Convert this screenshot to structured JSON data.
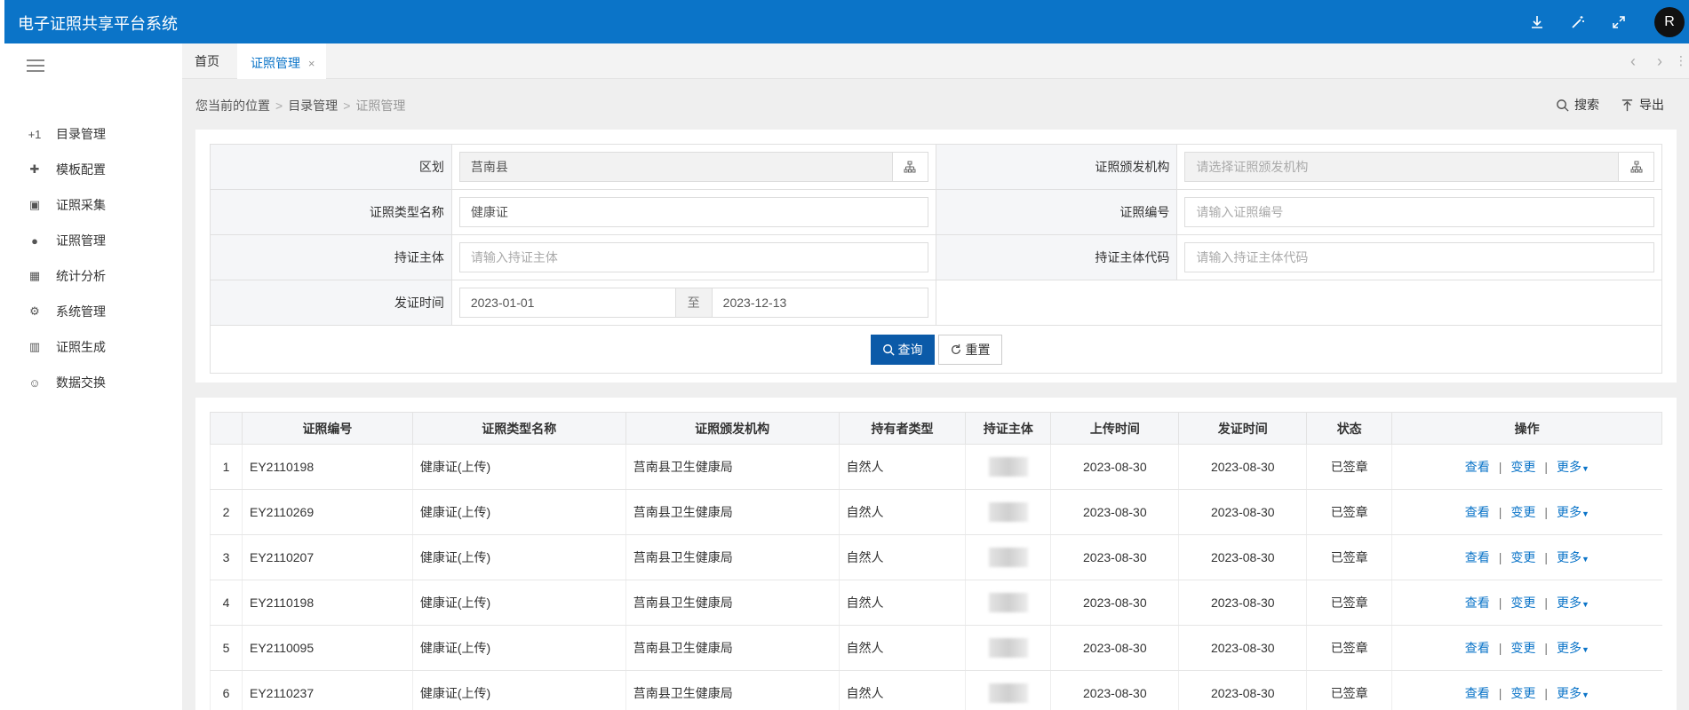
{
  "header": {
    "title": "电子证照共享平台系统",
    "icons": [
      "download-icon",
      "magic-wand-icon",
      "fullscreen-icon"
    ],
    "avatar_letter": "R"
  },
  "sidebar": {
    "items": [
      {
        "icon": "directory-icon",
        "glyph": "+1",
        "label": "目录管理"
      },
      {
        "icon": "puzzle-icon",
        "glyph": "✚",
        "label": "模板配置"
      },
      {
        "icon": "collect-icon",
        "glyph": "▣",
        "label": "证照采集"
      },
      {
        "icon": "chat-icon",
        "glyph": "●",
        "label": "证照管理"
      },
      {
        "icon": "chart-icon",
        "glyph": "▦",
        "label": "统计分析"
      },
      {
        "icon": "gear-icon",
        "glyph": "⚙",
        "label": "系统管理"
      },
      {
        "icon": "building-icon",
        "glyph": "▥",
        "label": "证照生成"
      },
      {
        "icon": "smile-icon",
        "glyph": "☺",
        "label": "数据交换"
      }
    ]
  },
  "tabs": {
    "home": "首页",
    "active": "证照管理",
    "close": "×"
  },
  "breadcrumb": {
    "prefix": "您当前的位置",
    "level1": "目录管理",
    "current": "证照管理",
    "sep": ">"
  },
  "actions": {
    "search": "搜索",
    "export": "导出"
  },
  "filters": {
    "region_label": "区划",
    "region_value": "莒南县",
    "issuer_label": "证照颁发机构",
    "issuer_placeholder": "请选择证照颁发机构",
    "type_label": "证照类型名称",
    "type_value": "健康证",
    "number_label": "证照编号",
    "number_placeholder": "请输入证照编号",
    "holder_label": "持证主体",
    "holder_placeholder": "请输入持证主体",
    "holder_code_label": "持证主体代码",
    "holder_code_placeholder": "请输入持证主体代码",
    "date_label": "发证时间",
    "date_from": "2023-01-01",
    "date_to_sep": "至",
    "date_to": "2023-12-13",
    "query_btn": "查询",
    "reset_btn": "重置"
  },
  "table": {
    "columns": [
      "",
      "证照编号",
      "证照类型名称",
      "证照颁发机构",
      "持有者类型",
      "持证主体",
      "上传时间",
      "发证时间",
      "状态",
      "操作"
    ],
    "op_view": "查看",
    "op_change": "变更",
    "op_more": "更多",
    "rows": [
      {
        "idx": "1",
        "number": "EY2110198",
        "type": "健康证(上传)",
        "issuer": "莒南县卫生健康局",
        "holder_type": "自然人",
        "upload": "2023-08-30",
        "issue": "2023-08-30",
        "status": "已签章"
      },
      {
        "idx": "2",
        "number": "EY2110269",
        "type": "健康证(上传)",
        "issuer": "莒南县卫生健康局",
        "holder_type": "自然人",
        "upload": "2023-08-30",
        "issue": "2023-08-30",
        "status": "已签章"
      },
      {
        "idx": "3",
        "number": "EY2110207",
        "type": "健康证(上传)",
        "issuer": "莒南县卫生健康局",
        "holder_type": "自然人",
        "upload": "2023-08-30",
        "issue": "2023-08-30",
        "status": "已签章"
      },
      {
        "idx": "4",
        "number": "EY2110198",
        "type": "健康证(上传)",
        "issuer": "莒南县卫生健康局",
        "holder_type": "自然人",
        "upload": "2023-08-30",
        "issue": "2023-08-30",
        "status": "已签章"
      },
      {
        "idx": "5",
        "number": "EY2110095",
        "type": "健康证(上传)",
        "issuer": "莒南县卫生健康局",
        "holder_type": "自然人",
        "upload": "2023-08-30",
        "issue": "2023-08-30",
        "status": "已签章"
      },
      {
        "idx": "6",
        "number": "EY2110237",
        "type": "健康证(上传)",
        "issuer": "莒南县卫生健康局",
        "holder_type": "自然人",
        "upload": "2023-08-30",
        "issue": "2023-08-30",
        "status": "已签章"
      }
    ]
  },
  "colors": {
    "header_bg": "#0b74c8",
    "primary_btn": "#0b5aa8",
    "link": "#0b74c8"
  }
}
